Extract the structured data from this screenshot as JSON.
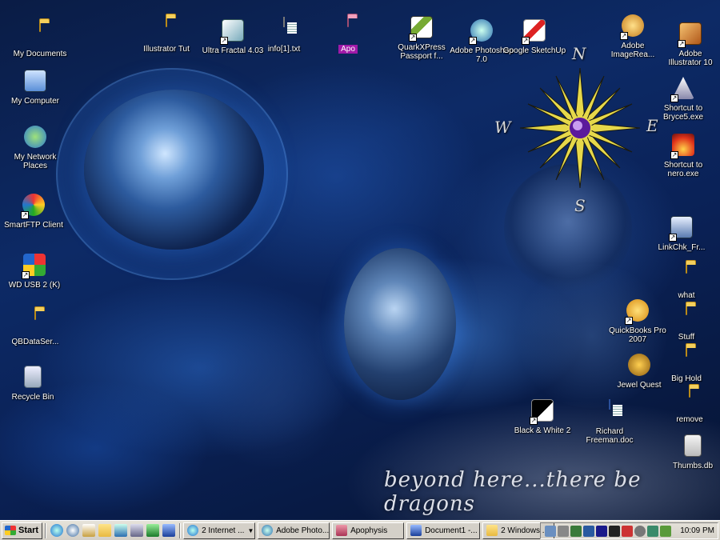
{
  "wallpaper": {
    "tagline": "beyond here...there be dragons",
    "compass_letters": {
      "n": "N",
      "e": "E",
      "s": "S",
      "w": "W"
    }
  },
  "desktop_icons": {
    "my_documents": "My Documents",
    "my_computer": "My Computer",
    "my_network_places": "My Network Places",
    "smartftp": "SmartFTP Client",
    "wd_usb": "WD USB 2 (K)",
    "qbdataserver": "QBDataSer...",
    "recycle_bin": "Recycle Bin",
    "illustrator_tut": "Illustrator Tut",
    "ultra_fractal": "Ultra Fractal 4.03",
    "info_txt": "info[1].txt",
    "apo": "Apo",
    "quarkxpress": "QuarkXPress Passport f...",
    "photoshop": "Adobe Photoshop 7.0",
    "google_sketchup": "Google SketchUp",
    "adobe_imageready": "Adobe ImageRea...",
    "adobe_illustrator": "Adobe Illustrator 10",
    "bryce": "Shortcut to Bryce5.exe",
    "nero": "Shortcut to nero.exe",
    "linkchk": "LinkChk_Fr...",
    "what": "what",
    "stuff": "Stuff",
    "big_hold": "Big Hold",
    "remove": "remove",
    "thumbs_db": "Thumbs.db",
    "quickbooks": "QuickBooks Pro 2007",
    "jewel_quest": "Jewel Quest",
    "black_white": "Black & White 2",
    "richard_freeman": "Richard Freeman.doc"
  },
  "taskbar": {
    "start_label": "Start",
    "quick_launch": [
      "ie-icon",
      "media-player-icon",
      "outlook-icon",
      "explorer-icon",
      "photoshop-icon",
      "show-desktop-icon",
      "excel-icon",
      "word-icon"
    ],
    "tasks": [
      {
        "label": "2 Internet ...",
        "icon": "ie-icon",
        "grouped": true
      },
      {
        "label": "Adobe Photo...",
        "icon": "photoshop-icon",
        "grouped": false
      },
      {
        "label": "Apophysis",
        "icon": "apophysis-icon",
        "grouped": false
      },
      {
        "label": "Document1 -...",
        "icon": "word-icon",
        "grouped": false
      },
      {
        "label": "2 Windows ...",
        "icon": "folder-icon",
        "grouped": true
      }
    ],
    "clock": "10:09 PM"
  },
  "colors": {
    "accent_selection": "#a01aa8",
    "taskbar_bg": "#d4d0c8"
  }
}
